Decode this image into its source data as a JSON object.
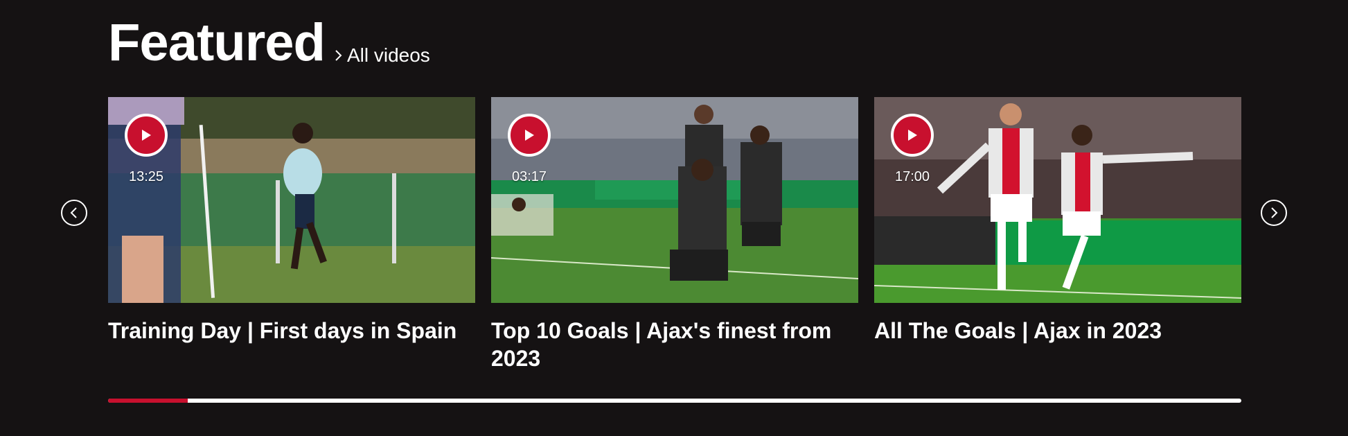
{
  "header": {
    "title": "Featured",
    "all_videos_label": "All videos"
  },
  "colors": {
    "accent": "#c8102e",
    "background": "#151213",
    "text": "#ffffff"
  },
  "navigation": {
    "prev_icon": "chevron-left-icon",
    "next_icon": "chevron-right-icon"
  },
  "videos": [
    {
      "title": "Training Day | First days in Spain",
      "duration": "13:25",
      "icon": "play-icon"
    },
    {
      "title": "Top 10 Goals | Ajax's finest from 2023",
      "duration": "03:17",
      "icon": "play-icon"
    },
    {
      "title": "All The Goals | Ajax in 2023",
      "duration": "17:00",
      "icon": "play-icon"
    }
  ],
  "carousel_progress": 0.07
}
